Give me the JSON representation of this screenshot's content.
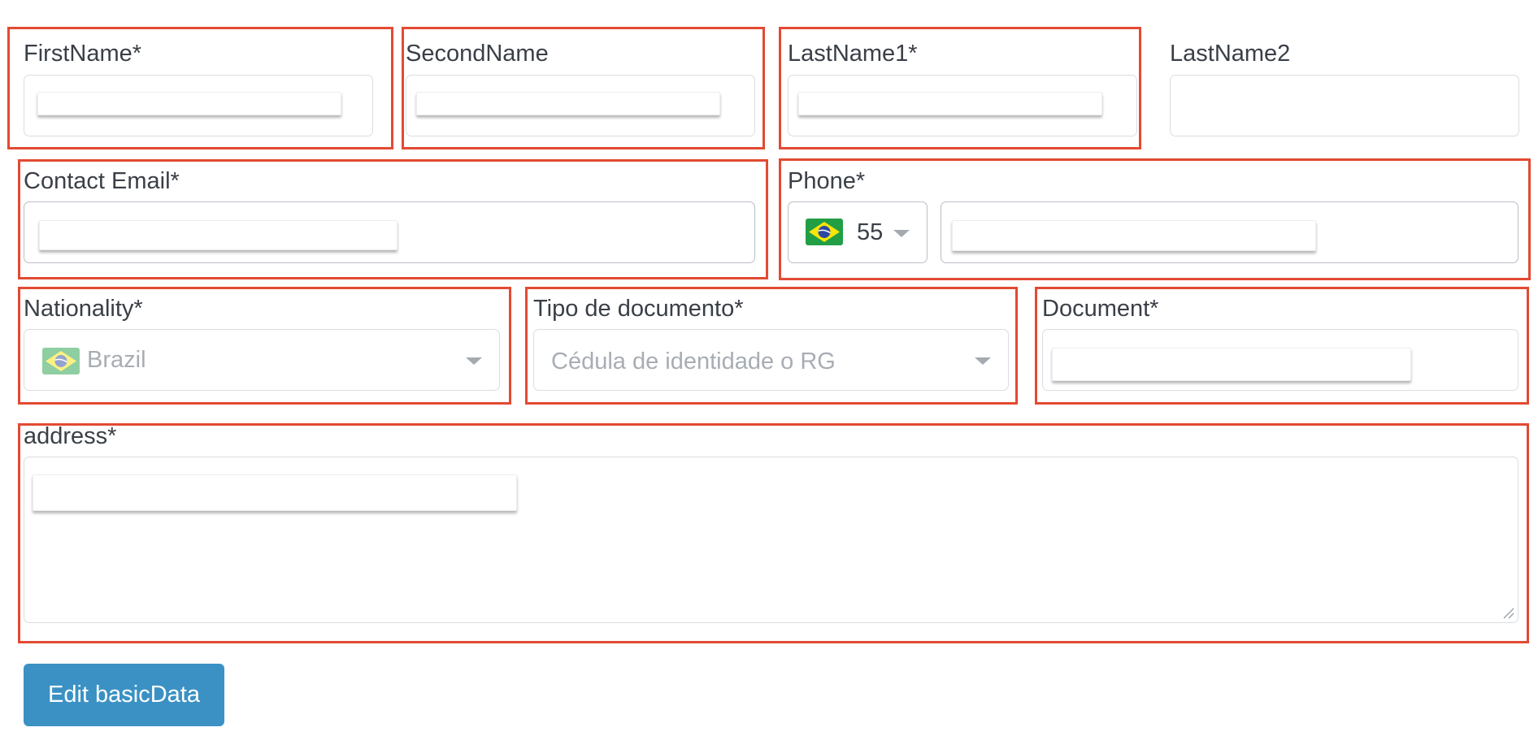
{
  "form": {
    "first_name_label": "FirstName*",
    "second_name_label": "SecondName",
    "last_name1_label": "LastName1*",
    "last_name2_label": "LastName2",
    "contact_email_label": "Contact Email*",
    "phone_label": "Phone*",
    "phone_country_code": "55",
    "nationality_label": "Nationality*",
    "nationality_value": "Brazil",
    "document_type_label": "Tipo de documento*",
    "document_type_value": "Cédula de identidade o RG",
    "document_label": "Document*",
    "address_label": "address*",
    "submit_label": "Edit basicData"
  },
  "icons": {
    "phone_flag": "brazil-flag-icon",
    "nationality_flag": "brazil-flag-icon",
    "dropdown": "chevron-down-icon",
    "resize": "resize-grip-icon"
  },
  "colors": {
    "highlight": "#e34a33",
    "button": "#3b91c4",
    "field_border": "#d9dde2",
    "placeholder": "#a8adb4"
  }
}
